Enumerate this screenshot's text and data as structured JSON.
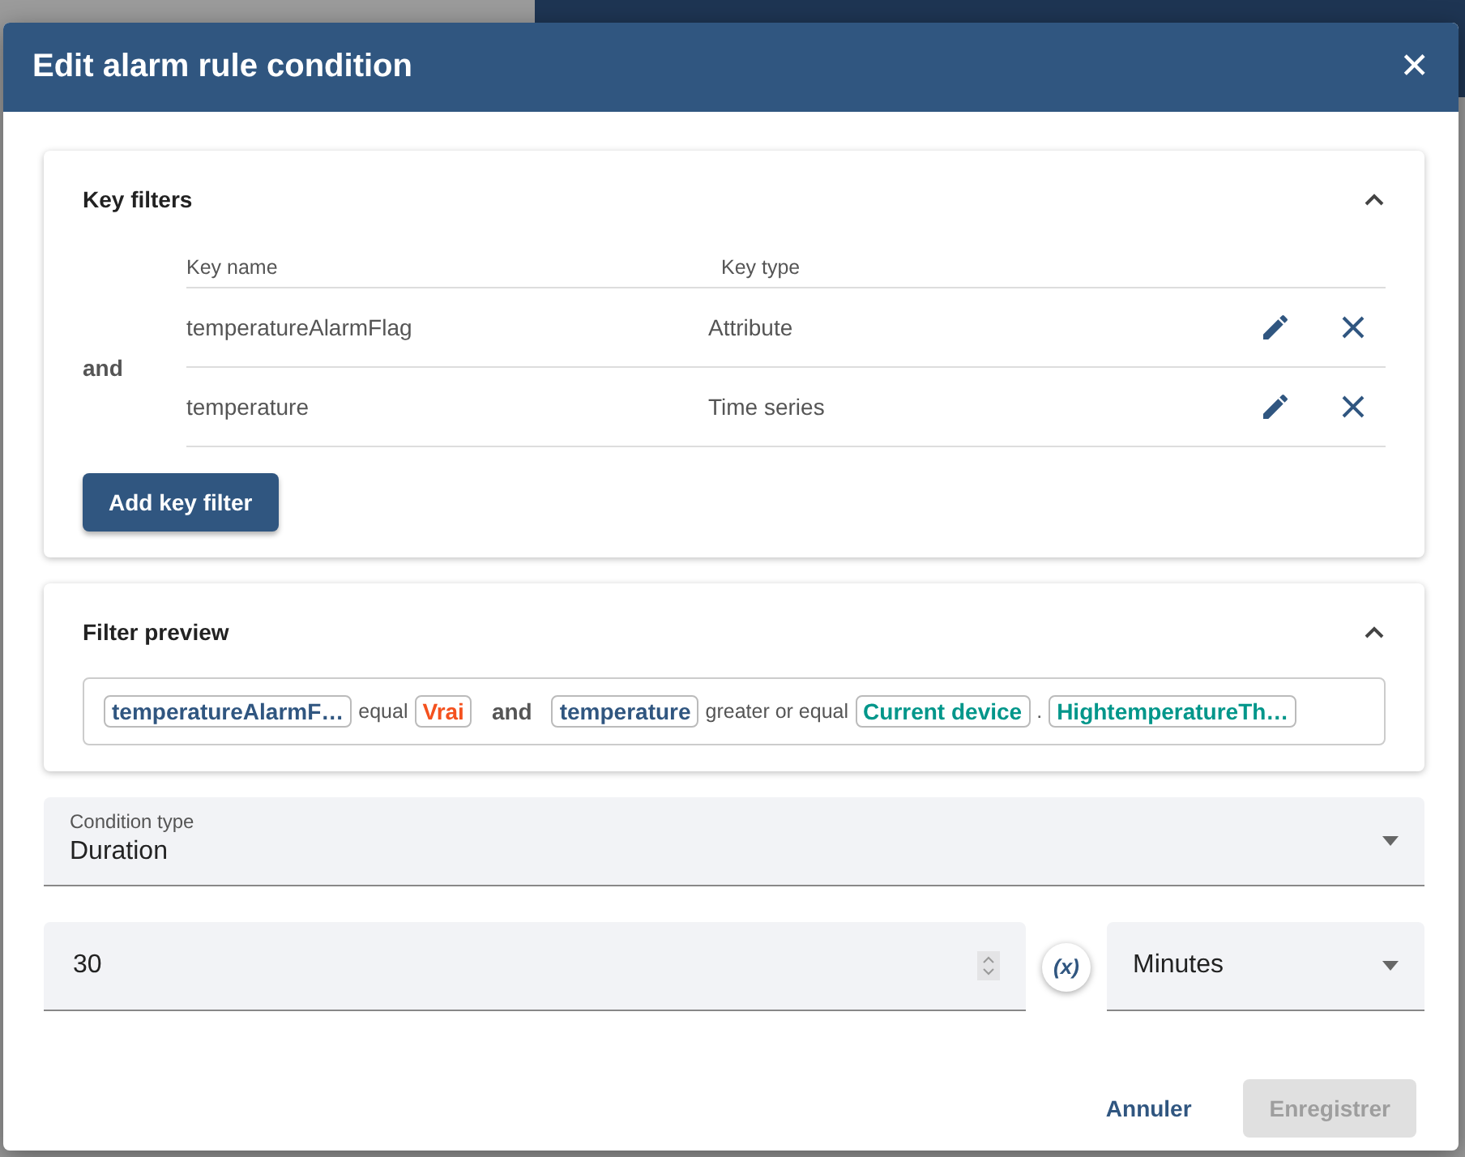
{
  "dialog": {
    "title": "Edit alarm rule condition",
    "close": "✕"
  },
  "key_filters": {
    "title": "Key filters",
    "expanded": true,
    "operator": "and",
    "columns": [
      "Key name",
      "Key type"
    ],
    "rows": [
      {
        "key_name": "temperatureAlarmFlag",
        "key_type": "Attribute"
      },
      {
        "key_name": "temperature",
        "key_type": "Time series"
      }
    ],
    "add_button": "Add key filter"
  },
  "filter_preview": {
    "title": "Filter preview",
    "expanded": true,
    "tokens": [
      {
        "kind": "key",
        "text": "temperatureAlarmF…"
      },
      {
        "kind": "text",
        "text": "equal"
      },
      {
        "kind": "value",
        "text": "Vrai"
      },
      {
        "kind": "operator",
        "text": "and"
      },
      {
        "kind": "key",
        "text": "temperature"
      },
      {
        "kind": "text",
        "text": "greater or equal"
      },
      {
        "kind": "dynamic",
        "text": "Current device"
      },
      {
        "kind": "separator",
        "text": "."
      },
      {
        "kind": "dynamic",
        "text": "HightemperatureTh…"
      }
    ]
  },
  "condition_type": {
    "label": "Condition type",
    "value": "Duration"
  },
  "duration": {
    "value": "30",
    "variable_button": "(x)",
    "unit": "Minutes"
  },
  "actions": [
    {
      "kind": "text",
      "label": "Annuler",
      "disabled": false
    },
    {
      "kind": "raised",
      "label": "Enregistrer",
      "disabled": true
    }
  ]
}
